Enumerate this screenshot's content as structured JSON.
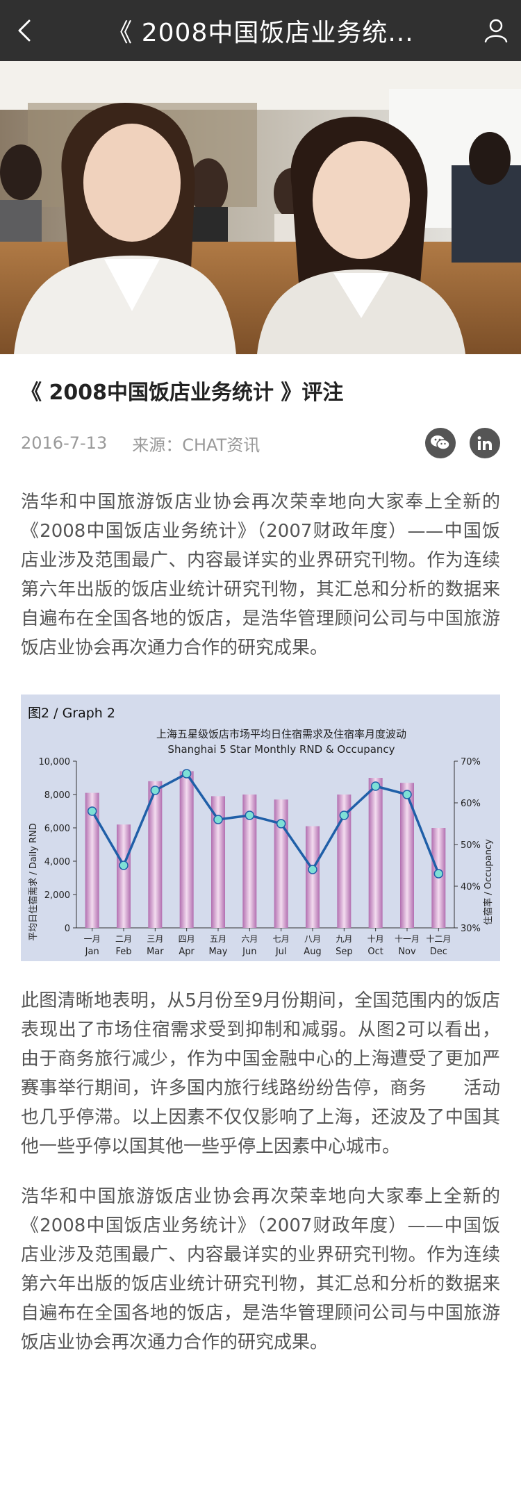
{
  "header": {
    "title": "《 2008中国饭店业务统..."
  },
  "article": {
    "headline": "《 2008中国饭店业务统计 》评注",
    "date": "2016-7-13",
    "source": "来源：CHAT资讯",
    "paragraph1": "浩华和中国旅游饭店业协会再次荣幸地向大家奉上全新的《2008中国饭店业务统计》（2007财政年度）——中国饭店业涉及范围最广、内容最详实的业界研究刊物。作为连续第六年出版的饭店业统计研究刊物，其汇总和分析的数据来自遍布在全国各地的饭店，是浩华管理顾问公司与中国旅游饭店业协会再次通力合作的研究成果。",
    "paragraph2": "此图清晰地表明，从5月份至9月份期间，全国范围内的饭店表现出了市场住宿需求受到抑制和减弱。从图2可以看出，由于商务旅行减少，作为中国金融中心的上海遭受了更加严赛事举行期间，许多国内旅行线路纷纷告停，商务　　活动也几乎停滞。以上因素不仅仅影响了上海，还波及了中国其他一些乎停以国其他一些乎停上因素中心城市。",
    "paragraph3": "浩华和中国旅游饭店业协会再次荣幸地向大家奉上全新的《2008中国饭店业务统计》（2007财政年度）——中国饭店业涉及范围最广、内容最详实的业界研究刊物。作为连续第六年出版的饭店业统计研究刊物，其汇总和分析的数据来自遍布在全国各地的饭店，是浩华管理顾问公司与中国旅游饭店业协会再次通力合作的研究成果。"
  },
  "icons": [
    "back-chevron-icon",
    "user-icon",
    "wechat-icon",
    "linkedin-icon"
  ],
  "colors": {
    "topbar": "#303030",
    "bars": "#c78fc4",
    "line": "#1f5fa8",
    "points": "#7ee0d6",
    "figure_bg": "#d4dbec"
  },
  "chart_data": {
    "type": "bar",
    "label": "图2 / Graph 2",
    "title": "上海五星级饭店市场平均日住宿需求及住宿率月度波动",
    "subtitle": "Shanghai 5 Star Monthly RND & Occupancy",
    "categories_cn": [
      "一月",
      "二月",
      "三月",
      "四月",
      "五月",
      "六月",
      "七月",
      "八月",
      "九月",
      "十月",
      "十一月",
      "十二月"
    ],
    "categories": [
      "Jan",
      "Feb",
      "Mar",
      "Apr",
      "May",
      "Jun",
      "Jul",
      "Aug",
      "Sep",
      "Oct",
      "Nov",
      "Dec"
    ],
    "ylabel": "平均日住宿需求 / Daily RND",
    "y2label": "住宿率 / Occupancy",
    "ylim": [
      0,
      10000
    ],
    "y2lim": [
      30,
      70
    ],
    "yticks": [
      "0",
      "2,000",
      "4,000",
      "6,000",
      "8,000",
      "10,000"
    ],
    "y2ticks": [
      "30%",
      "40%",
      "50%",
      "60%",
      "70%"
    ],
    "series": [
      {
        "kind": "bar",
        "axis": "left",
        "values": [
          8100,
          6200,
          8800,
          9400,
          7900,
          8000,
          7700,
          6100,
          8000,
          9000,
          8700,
          6000
        ]
      },
      {
        "kind": "line",
        "axis": "right",
        "values": [
          58,
          45,
          63,
          67,
          56,
          57,
          55,
          44,
          57,
          64,
          62,
          43
        ]
      }
    ],
    "grid": false
  }
}
